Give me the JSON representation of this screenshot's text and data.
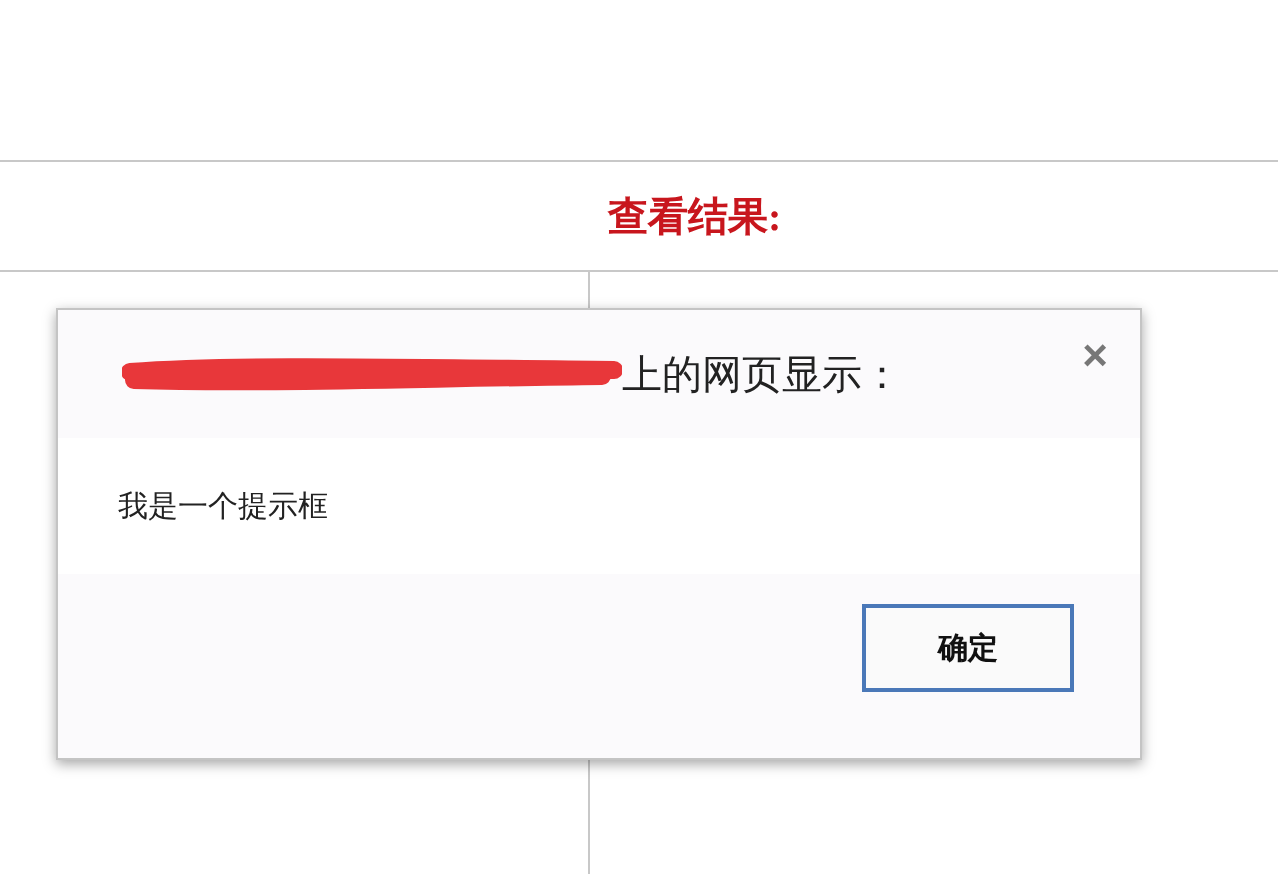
{
  "page": {
    "heading": "查看结果:"
  },
  "dialog": {
    "title": "上的网页显示：",
    "close": "×",
    "message": "我是一个提示框",
    "buttons": [
      {
        "label": "确定",
        "focused": true
      }
    ]
  }
}
